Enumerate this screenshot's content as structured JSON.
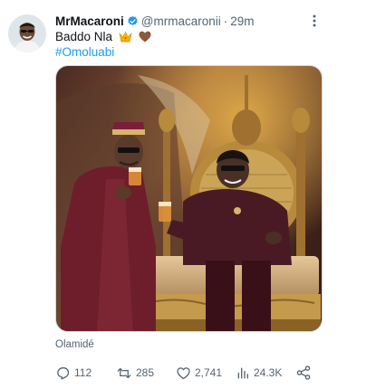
{
  "tweet": {
    "author": {
      "display_name": "MrMacaroni",
      "handle": "@mrmacaronii",
      "separator": "·",
      "time": "29m",
      "verified": true
    },
    "text": "Baddo Nla",
    "emojis": [
      "crown-emoji",
      "brown-heart-emoji"
    ],
    "hashtag": "#Omoluabi",
    "media_tag": "Olamidé",
    "stats": {
      "replies": "112",
      "reposts": "285",
      "likes": "2,741",
      "views": "24.3K"
    }
  },
  "colors": {
    "accent": "#1d9bf0",
    "secondary_text": "#536471",
    "primary_text": "#0f1419"
  }
}
